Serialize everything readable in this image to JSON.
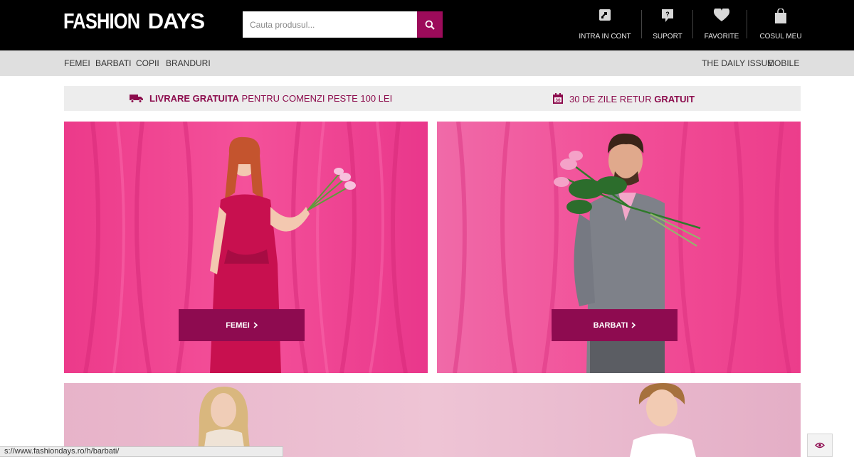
{
  "header": {
    "logo_part1": "FASHION",
    "logo_part2": "DAYS",
    "search_placeholder": "Cauta produsul...",
    "links": [
      {
        "label": "INTRA IN CONT",
        "icon": "account-icon"
      },
      {
        "label": "SUPORT",
        "icon": "support-icon"
      },
      {
        "label": "FAVORITE",
        "icon": "heart-icon"
      },
      {
        "label": "COSUL MEU",
        "icon": "cart-bag-icon"
      }
    ]
  },
  "nav": {
    "left": [
      "FEMEI",
      "BARBATI",
      "COPII",
      "BRANDURI"
    ],
    "right": [
      "THE DAILY ISSUE",
      "MOBILE"
    ]
  },
  "promo": {
    "shipping_bold": "LIVRARE GRATUITA",
    "shipping_rest": "PENTRU COMENZI PESTE 100 LEI",
    "return_icon_number": "30",
    "return_rest": "30 DE ZILE RETUR",
    "return_bold": "GRATUIT"
  },
  "banners": {
    "women_cta": "FEMEI",
    "men_cta": "BARBATI"
  },
  "status_bar": {
    "url": "s://www.fashiondays.ro/h/barbati/"
  },
  "colors": {
    "accent": "#8e0b50",
    "header_bg": "#000000",
    "nav_bg": "#dfdfdf",
    "banner_pink": "#f0418f"
  }
}
